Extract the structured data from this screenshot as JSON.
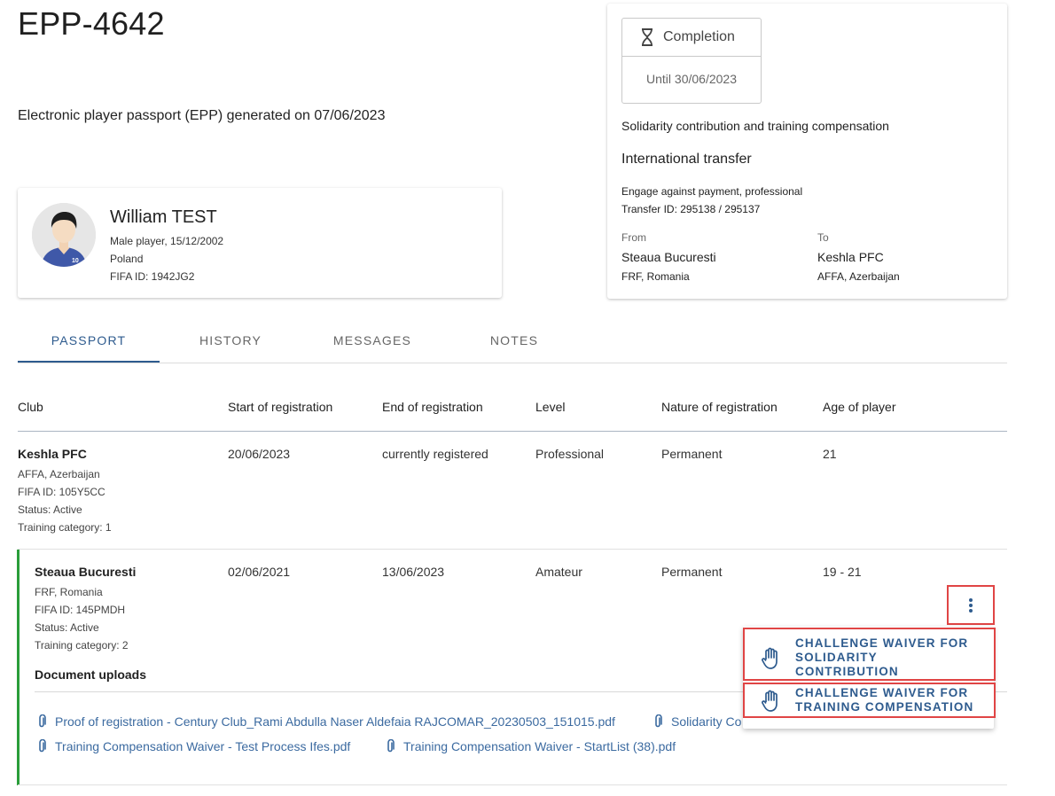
{
  "page": {
    "title": "EPP-4642",
    "generated_text": "Electronic player passport (EPP) generated on 07/06/2023"
  },
  "player": {
    "name": "William TEST",
    "gender_dob": "Male player, 15/12/2002",
    "country": "Poland",
    "fifa_id": "FIFA ID: 1942JG2",
    "jersey_number": "10"
  },
  "transfer_card": {
    "status_label": "Completion",
    "until": "Until 30/06/2023",
    "category": "Solidarity contribution and training compensation",
    "type": "International transfer",
    "engagement": "Engage against payment, professional",
    "transfer_id": "Transfer ID: 295138 / 295137",
    "from_label": "From",
    "from_club": "Steaua Bucuresti",
    "from_assoc": "FRF, Romania",
    "to_label": "To",
    "to_club": "Keshla PFC",
    "to_assoc": "AFFA, Azerbaijan"
  },
  "tabs": [
    "PASSPORT",
    "HISTORY",
    "MESSAGES",
    "NOTES"
  ],
  "active_tab": "PASSPORT",
  "table": {
    "headers": [
      "Club",
      "Start of registration",
      "End of registration",
      "Level",
      "Nature of registration",
      "Age of player"
    ],
    "rows": [
      {
        "club": "Keshla PFC",
        "assoc": "AFFA, Azerbaijan",
        "fifa_id": "FIFA ID: 105Y5CC",
        "status": "Status: Active",
        "training": "Training category: 1",
        "start": "20/06/2023",
        "end": "currently registered",
        "level": "Professional",
        "nature": "Permanent",
        "age": "21"
      },
      {
        "club": "Steaua Bucuresti",
        "assoc": "FRF, Romania",
        "fifa_id": "FIFA ID: 145PMDH",
        "status": "Status: Active",
        "training": "Training category: 2",
        "start": "02/06/2021",
        "end": "13/06/2023",
        "level": "Amateur",
        "nature": "Permanent",
        "age": "19 - 21"
      }
    ]
  },
  "documents": {
    "title": "Document uploads",
    "files": [
      "Proof of registration - Century Club_Rami Abdulla Naser Aldefaia RAJCOMAR_20230503_151015.pdf",
      "Solidarity Co",
      "Training Compensation Waiver - Test Process Ifes.pdf",
      "Training Compensation Waiver - StartList (38).pdf"
    ]
  },
  "context_menu": {
    "items": [
      [
        "CHALLENGE WAIVER FOR",
        "SOLIDARITY",
        "CONTRIBUTION"
      ],
      [
        "CHALLENGE WAIVER FOR",
        "TRAINING COMPENSATION"
      ]
    ]
  },
  "colors": {
    "accent": "#2e5b8e",
    "link": "#3b6aa0",
    "highlight_border": "#e04545",
    "active_row_bar": "#2a9d3a"
  },
  "icons": [
    "hourglass-icon",
    "more-vert-icon",
    "hand-icon",
    "paperclip-icon"
  ]
}
